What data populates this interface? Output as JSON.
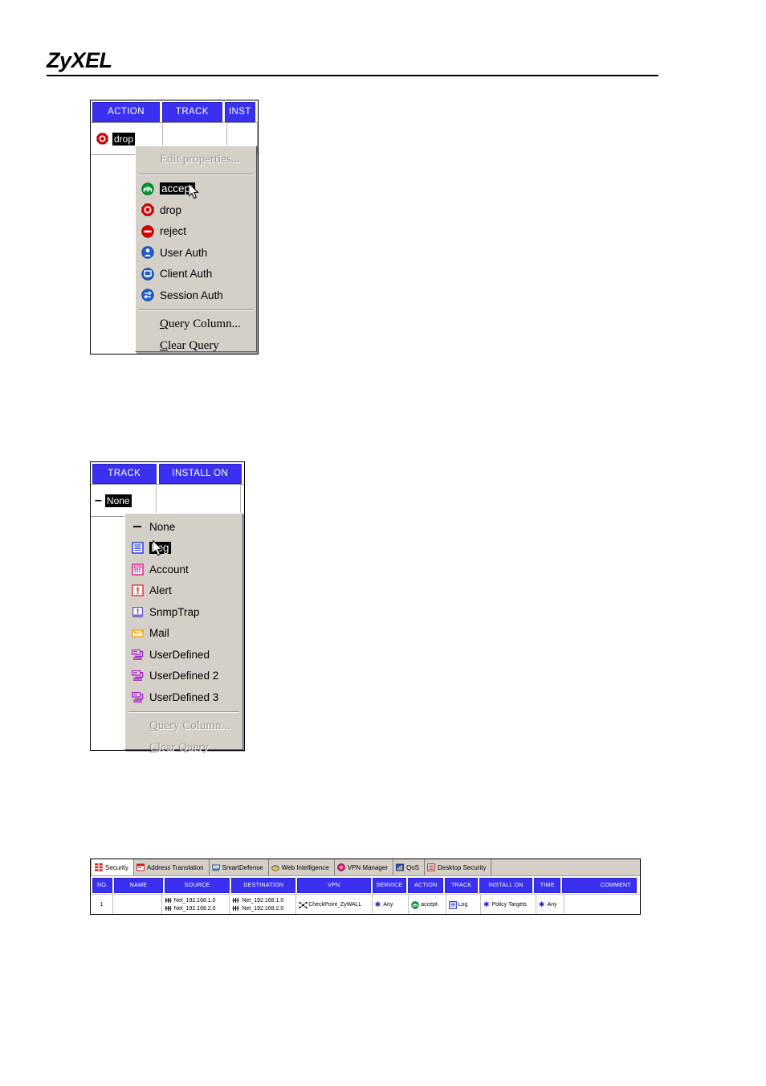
{
  "document": {
    "brand": "ZyXEL"
  },
  "action_panel": {
    "columns": [
      "ACTION",
      "TRACK",
      "INST"
    ],
    "cell_value": "drop",
    "cell_icon": "drop-icon"
  },
  "action_menu": {
    "edit_properties": {
      "label": "Edit properties...",
      "enabled": false
    },
    "items": [
      {
        "label": "accept",
        "icon": "accept-icon",
        "selected": true
      },
      {
        "label": "drop",
        "icon": "drop-icon",
        "selected": false
      },
      {
        "label": "reject",
        "icon": "reject-icon",
        "selected": false
      },
      {
        "label": "User Auth",
        "icon": "user-auth-icon",
        "selected": false
      },
      {
        "label": "Client Auth",
        "icon": "client-auth-icon",
        "selected": false
      },
      {
        "label": "Session Auth",
        "icon": "session-auth-icon",
        "selected": false
      }
    ],
    "footer": [
      {
        "accel": "Q",
        "rest": "uery Column...",
        "enabled": true
      },
      {
        "accel": "C",
        "rest": "lear Query",
        "enabled": true
      }
    ]
  },
  "track_panel": {
    "columns": [
      "TRACK",
      "INSTALL ON"
    ],
    "cell_value": "None",
    "cell_icon": "none-dash-icon"
  },
  "track_menu": {
    "items": [
      {
        "label": "None",
        "icon": "none-dash-icon",
        "selected": false
      },
      {
        "label": "Log",
        "icon": "log-icon",
        "selected": true
      },
      {
        "label": "Account",
        "icon": "account-icon",
        "selected": false
      },
      {
        "label": "Alert",
        "icon": "alert-icon",
        "selected": false
      },
      {
        "label": "SnmpTrap",
        "icon": "snmptrap-icon",
        "selected": false
      },
      {
        "label": "Mail",
        "icon": "mail-icon",
        "selected": false
      },
      {
        "label": "UserDefined",
        "icon": "userdefined-icon",
        "selected": false
      },
      {
        "label": "UserDefined 2",
        "icon": "userdefined-icon",
        "selected": false
      },
      {
        "label": "UserDefined 3",
        "icon": "userdefined-icon",
        "selected": false
      }
    ],
    "footer": [
      {
        "accel": "Q",
        "rest": "uery Column...",
        "enabled": false
      },
      {
        "accel": "C",
        "rest": "lear Query",
        "enabled": false
      }
    ]
  },
  "rulebase": {
    "tabs": [
      {
        "label": "Security",
        "icon": "security-icon",
        "active": true
      },
      {
        "label": "Address Translation",
        "icon": "nat-icon",
        "active": false
      },
      {
        "label": "SmartDefense",
        "icon": "smartdefense-icon",
        "active": false
      },
      {
        "label": "Web Intelligence",
        "icon": "webintel-icon",
        "active": false
      },
      {
        "label": "VPN Manager",
        "icon": "vpnmanager-icon",
        "active": false
      },
      {
        "label": "QoS",
        "icon": "qos-icon",
        "active": false
      },
      {
        "label": "Desktop Security",
        "icon": "desktopsec-icon",
        "active": false
      }
    ],
    "columns": [
      "NO.",
      "NAME",
      "SOURCE",
      "DESTINATION",
      "VPN",
      "SERVICE",
      "ACTION",
      "TRACK",
      "INSTALL ON",
      "TIME",
      "COMMENT"
    ],
    "row": {
      "no": "1",
      "name": "",
      "source": [
        "Net_192.168.1.0",
        "Net_192.168.2.0"
      ],
      "destination": [
        "Net_192.168.1.0",
        "Net_192.168.2.0"
      ],
      "vpn": "CheckPoint_ZyWALL",
      "service": "Any",
      "action": "accept",
      "track": "Log",
      "install_on": "Policy Targets",
      "time": "Any",
      "comment": ""
    }
  },
  "colors": {
    "header_blue": "#3b30ef",
    "menu_face": "#d4d0c8",
    "accept_green": "#009933",
    "drop_red": "#e00000",
    "reject_red": "#e00000",
    "auth_blue": "#1f5fd0",
    "log_blue": "#2233cc",
    "account_magenta": "#d02090",
    "alert_red": "#e03030",
    "snmp_purple": "#7755cc",
    "mail_orange": "#f0a000",
    "userdef_purple": "#a020c0",
    "star_blue": "#2222dd"
  }
}
